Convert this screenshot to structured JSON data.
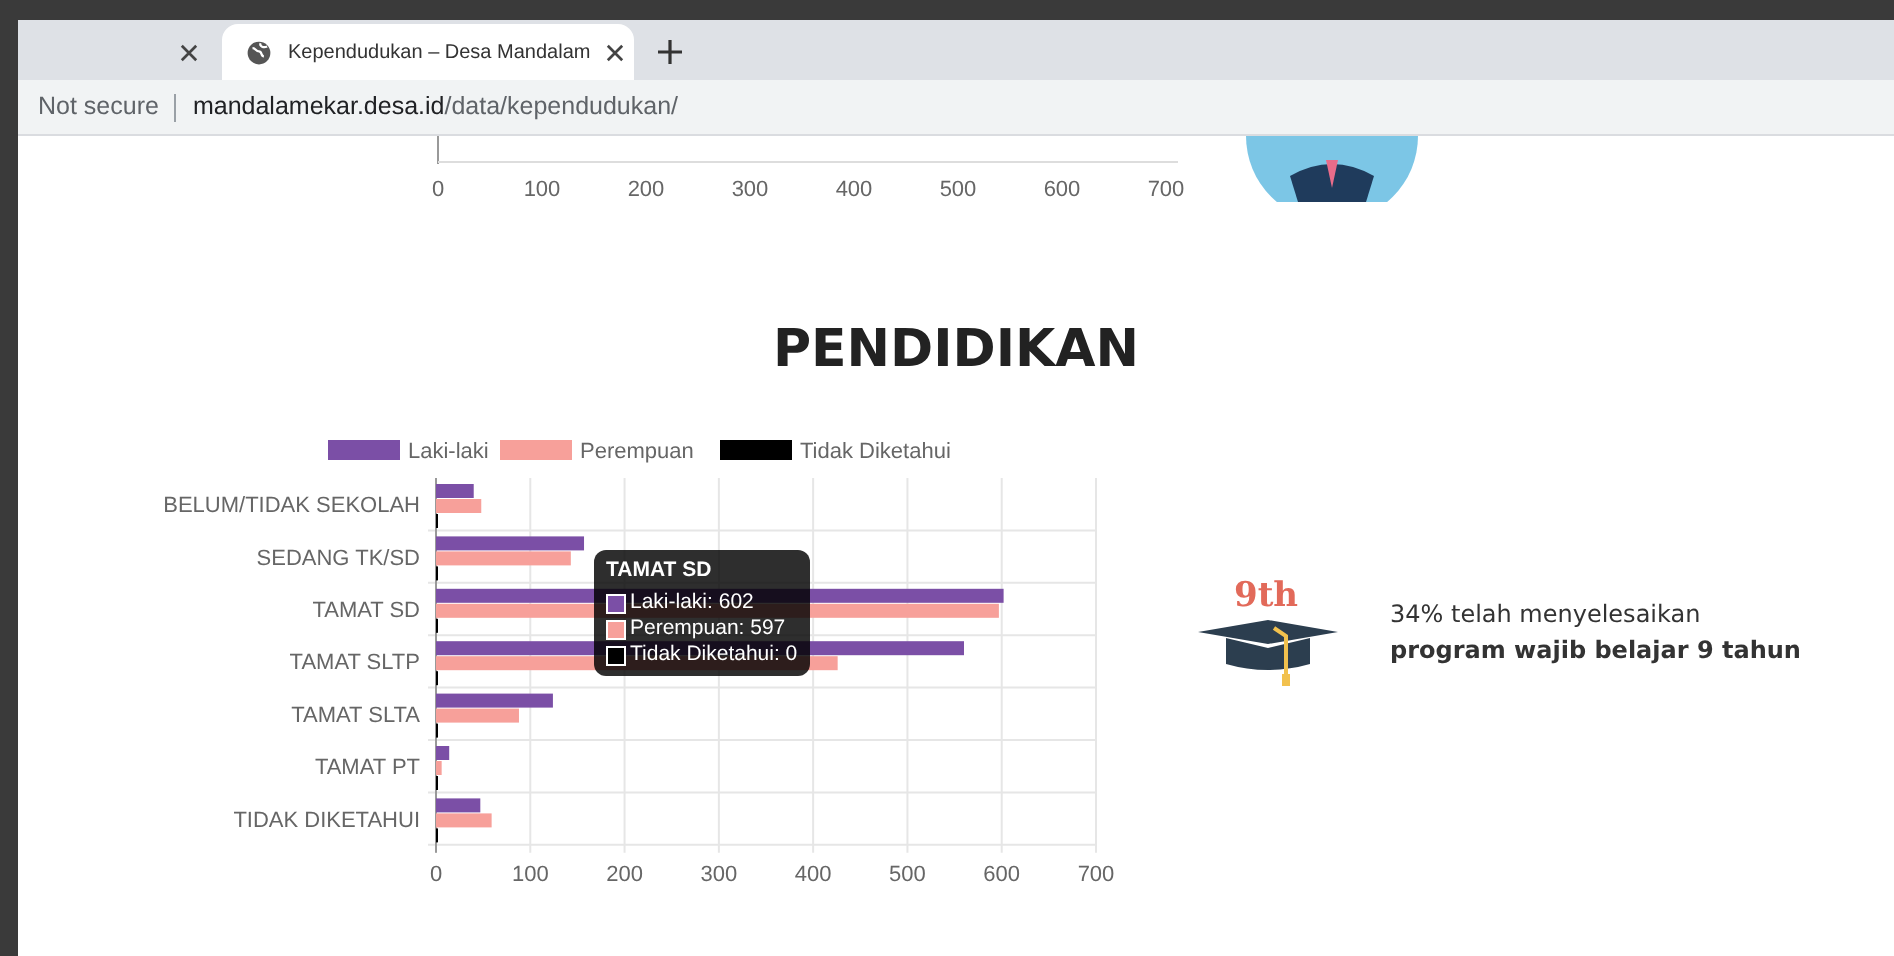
{
  "browser": {
    "tabs": [
      {
        "selected": false
      },
      {
        "title": "Kependudukan – Desa Mandalam",
        "selected": true
      }
    ],
    "security": "Not secure",
    "url_host": "mandalamekar.desa.id",
    "url_path": "/data/kependudukan/"
  },
  "previous_chart": {
    "tick_labels": [
      "0",
      "100",
      "200",
      "300",
      "400",
      "500",
      "600",
      "700"
    ]
  },
  "section_title": "PENDIDIKAN",
  "chart": {
    "chart_data": {
      "type": "bar",
      "orientation": "horizontal",
      "categories": [
        "BELUM/TIDAK SEKOLAH",
        "SEDANG TK/SD",
        "TAMAT SD",
        "TAMAT SLTP",
        "TAMAT SLTA",
        "TAMAT PT",
        "TIDAK DIKETAHUI"
      ],
      "series": [
        {
          "name": "Laki-laki",
          "color": "#7b4fa6",
          "values": [
            40,
            157,
            602,
            560,
            124,
            14,
            47
          ]
        },
        {
          "name": "Perempuan",
          "color": "#f7a09a",
          "values": [
            48,
            143,
            597,
            426,
            88,
            6,
            59
          ]
        },
        {
          "name": "Tidak Diketahui",
          "color": "#000000",
          "values": [
            0,
            0,
            0,
            0,
            0,
            0,
            0
          ]
        }
      ],
      "grid": true,
      "legend": true,
      "xlim": [
        0,
        700
      ],
      "xticks": [
        {
          "value": 0,
          "label": "0"
        },
        {
          "value": 100,
          "label": "100"
        },
        {
          "value": 200,
          "label": "200"
        },
        {
          "value": 300,
          "label": "300"
        },
        {
          "value": 400,
          "label": "400"
        },
        {
          "value": 500,
          "label": "500"
        },
        {
          "value": 600,
          "label": "600"
        },
        {
          "value": 700,
          "label": "700"
        }
      ]
    },
    "tooltip": {
      "title": "TAMAT SD",
      "lines": [
        "Laki-laki: 602",
        "Perempuan: 597",
        "Tidak Diketahui: 0"
      ]
    }
  },
  "info": {
    "badge": "9th",
    "line1": "34% telah menyelesaikan",
    "line2": "program wajib belajar 9 tahun"
  }
}
